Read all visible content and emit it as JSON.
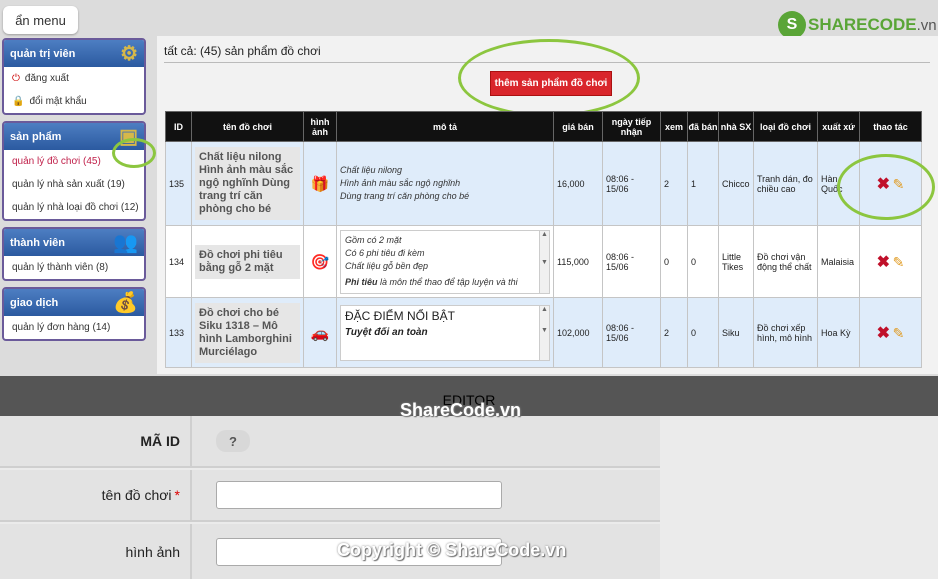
{
  "menu_toggle": "ẩn menu",
  "logo": {
    "brand": "SHARECODE",
    "tld": ".vn"
  },
  "sidebar": [
    {
      "title": "quản trị viên",
      "icon": "gear-icon",
      "items": [
        "đăng xuất",
        "đổi mật khẩu"
      ]
    },
    {
      "title": "sản phẩm",
      "icon": "box-icon",
      "items": [
        "quản lý đồ chơi (45)",
        "quản lý nhà sản xuất (19)",
        "quản lý nhà loại đồ chơi (12)"
      ]
    },
    {
      "title": "thành viên",
      "icon": "users-icon",
      "items": [
        "quản lý thành viên (8)"
      ]
    },
    {
      "title": "giao dịch",
      "icon": "money-bag-icon",
      "items": [
        "quản lý đơn hàng (14)"
      ]
    }
  ],
  "main": {
    "count_text": "tất cả: (45) sản phẩm đồ chơi",
    "add_button": "thêm sản phẩm đồ chơi",
    "columns": [
      "ID",
      "tên đồ chơi",
      "hình ảnh",
      "mô tả",
      "giá bán",
      "ngày tiếp nhận",
      "xem",
      "đã bán",
      "nhà SX",
      "loại đồ chơi",
      "xuất xứ",
      "thao tác"
    ],
    "rows": [
      {
        "id": "135",
        "name": "Chất liệu nilong Hình ảnh màu sắc ngộ nghĩnh Dùng trang trí căn phòng cho bé",
        "image": "gift-icon",
        "desc": [
          "Chất liệu nilong",
          "Hình ảnh màu sắc ngộ nghĩnh",
          "Dùng trang trí căn phòng cho bé"
        ],
        "price": "16,000",
        "date": "08:06 - 15/06",
        "views": "2",
        "sold": "1",
        "maker": "Chicco",
        "type": "Tranh dán, đo chiều cao",
        "origin": "Hàn Quốc"
      },
      {
        "id": "134",
        "name": "Đồ chơi phi tiêu bằng gỗ 2 mặt",
        "image": "dartboard-icon",
        "desc": [
          "Gồm có 2 mặt",
          "Có 6 phi tiêu đi kèm",
          "Chất liệu gỗ bền đẹp"
        ],
        "desc_extra_bold": "Phi tiêu",
        "desc_extra": " là môn thể thao để tập luyện và thi",
        "price": "115,000",
        "date": "08:06 - 15/06",
        "views": "0",
        "sold": "0",
        "maker": "Little Tikes",
        "type": "Đồ chơi vận động thể chất",
        "origin": "Malaisia"
      },
      {
        "id": "133",
        "name": "Đồ chơi cho bé Siku 1318 – Mô hình Lamborghini Murciélago",
        "image": "car-icon",
        "desc_heading": "ĐẶC ĐIỂM NỔI BẬT",
        "desc_sub": "Tuyệt đối an toàn",
        "price": "102,000",
        "date": "08:06 - 15/06",
        "views": "2",
        "sold": "0",
        "maker": "Siku",
        "type": "Đồ chơi xếp hình, mô hình",
        "origin": "Hoa Kỳ"
      }
    ]
  },
  "editor": {
    "title": "EDITOR",
    "fields": [
      {
        "label": "MÃ ID",
        "control": "?"
      },
      {
        "label": "tên đồ chơi",
        "required": "*"
      },
      {
        "label": "hình ảnh"
      }
    ]
  },
  "watermarks": [
    "ShareCode.vn",
    "Copyright © ShareCode.vn"
  ],
  "colors": {
    "accent_red": "#d9262c",
    "highlight_green": "#8cc63f",
    "sidebar_header": "#2b5aa0"
  }
}
